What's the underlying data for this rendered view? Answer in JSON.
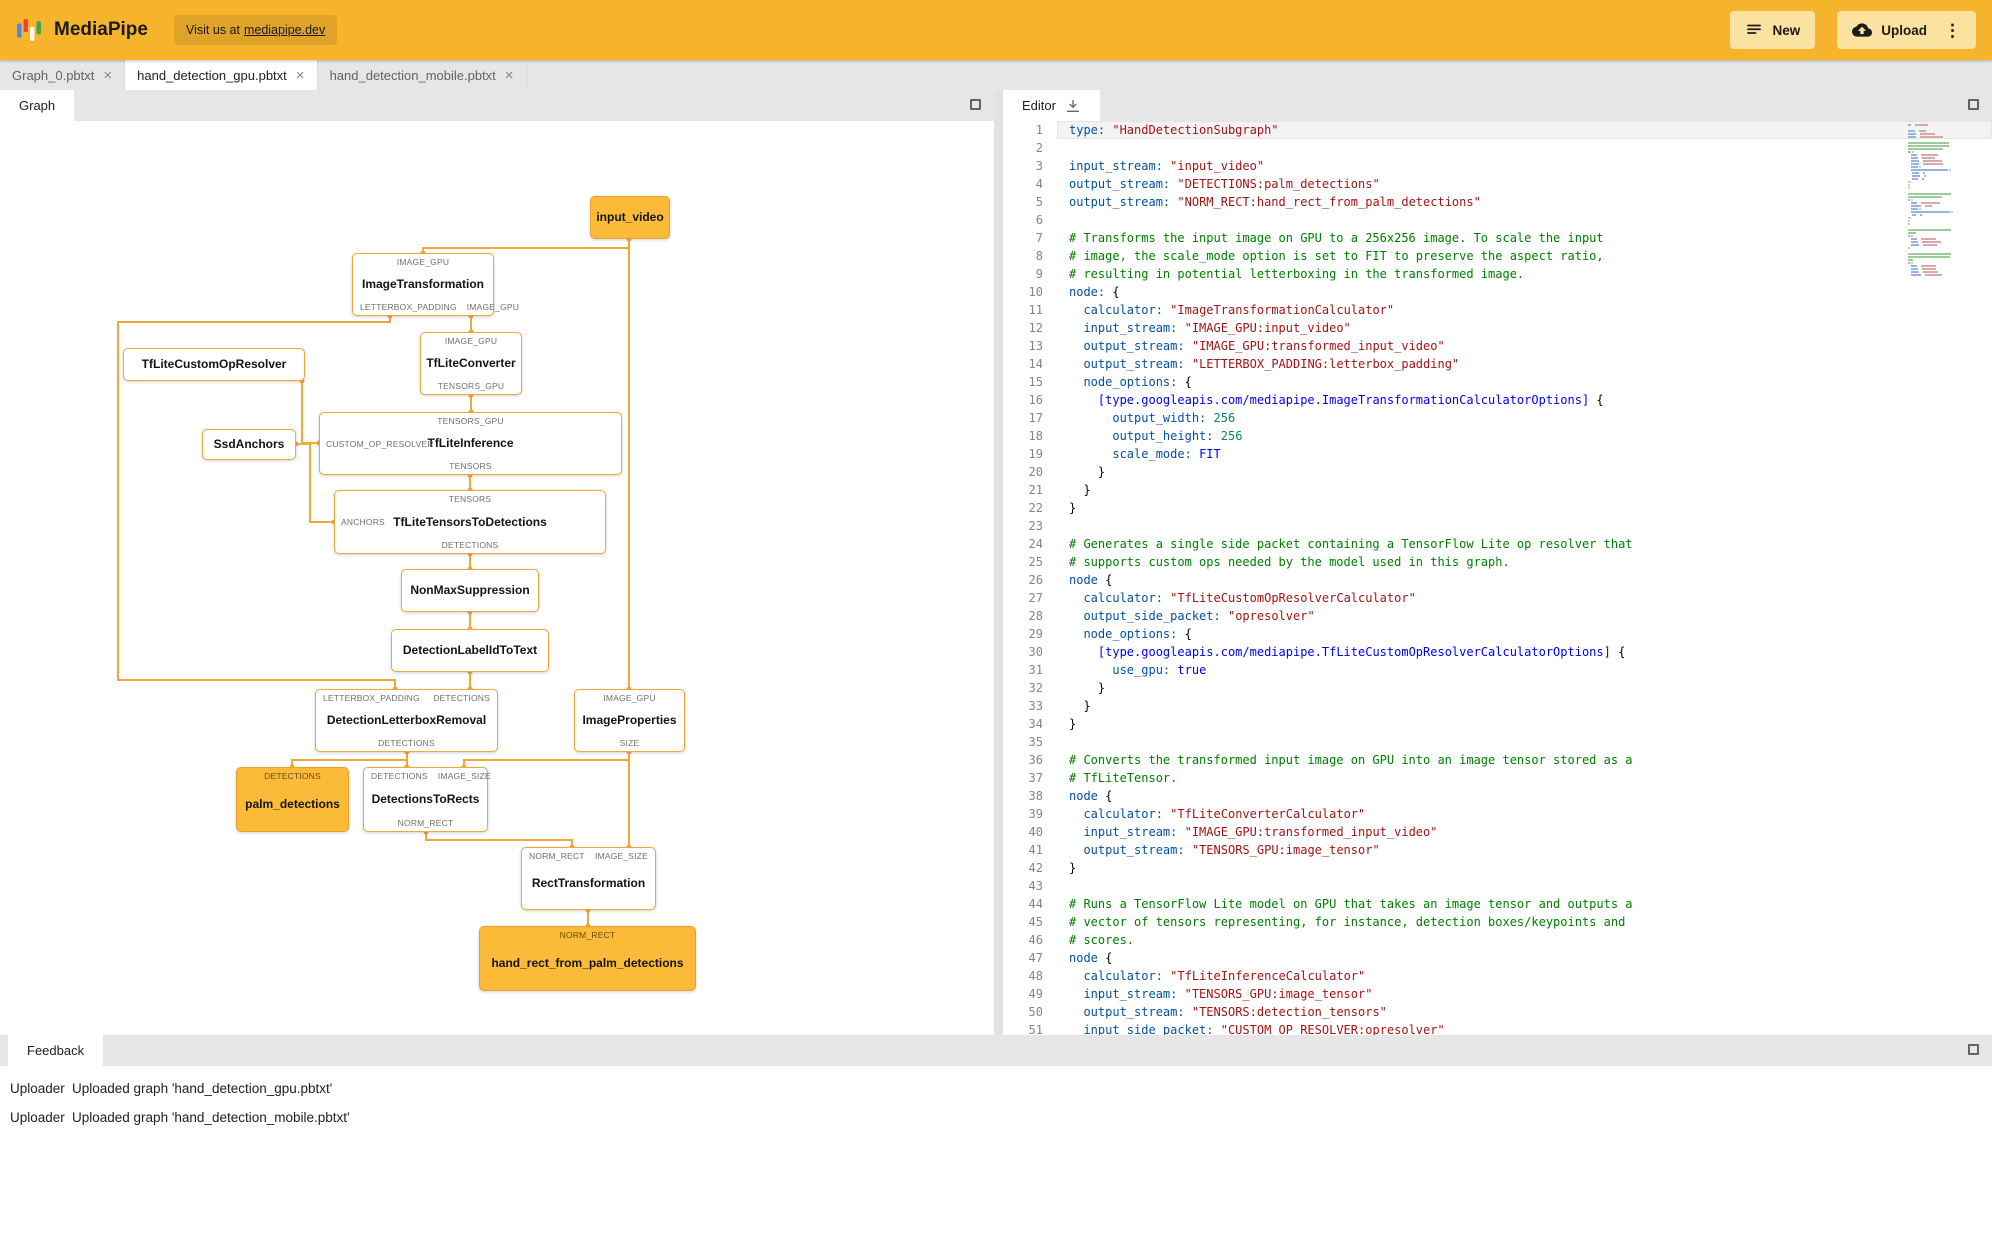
{
  "colors": {
    "header_bg": "#F6B42C",
    "badge_bg": "#DFA32A",
    "button_bg": "#FBE2A0",
    "edge_amber": "#F0A73C",
    "packet_fill": "#FBBA37",
    "packet_border": "#E8A02C",
    "code_key": "#0451A5",
    "code_string": "#A31515",
    "code_comment": "#008000",
    "code_number": "#098658",
    "code_keyword": "#0000FF"
  },
  "header": {
    "title": "MediaPipe",
    "visit_prefix": "Visit us at",
    "visit_link": "mediapipe.dev",
    "new_label": "New",
    "upload_label": "Upload"
  },
  "file_tabs": [
    {
      "label": "Graph_0.pbtxt",
      "active": false
    },
    {
      "label": "hand_detection_gpu.pbtxt",
      "active": true
    },
    {
      "label": "hand_detection_mobile.pbtxt",
      "active": false
    }
  ],
  "graph_panel": {
    "tab": "Graph",
    "nodes": [
      {
        "id": "input_video",
        "title": "input_video",
        "kind": "packet"
      },
      {
        "id": "ImageTransformation",
        "title": "ImageTransformation",
        "kind": "calc",
        "top_ports": [
          "IMAGE_GPU"
        ],
        "bottom_ports": [
          "LETTERBOX_PADDING",
          "IMAGE_GPU"
        ]
      },
      {
        "id": "TfLiteConverter",
        "title": "TfLiteConverter",
        "kind": "calc",
        "top_ports": [
          "IMAGE_GPU"
        ],
        "bottom_ports": [
          "TENSORS_GPU"
        ]
      },
      {
        "id": "TfLiteCustomOpResolver",
        "title": "TfLiteCustomOpResolver",
        "kind": "calc"
      },
      {
        "id": "SsdAnchors",
        "title": "SsdAnchors",
        "kind": "calc"
      },
      {
        "id": "TfLiteInference",
        "title": "TfLiteInference",
        "kind": "calc",
        "top_ports": [
          "TENSORS_GPU"
        ],
        "bottom_ports": [
          "TENSORS"
        ],
        "left_port": "CUSTOM_OP_RESOLVER"
      },
      {
        "id": "TfLiteTensorsToDetections",
        "title": "TfLiteTensorsToDetections",
        "kind": "calc",
        "top_ports": [
          "TENSORS"
        ],
        "bottom_ports": [
          "DETECTIONS"
        ],
        "left_port": "ANCHORS"
      },
      {
        "id": "NonMaxSuppression",
        "title": "NonMaxSuppression",
        "kind": "calc"
      },
      {
        "id": "DetectionLabelIdToText",
        "title": "DetectionLabelIdToText",
        "kind": "calc"
      },
      {
        "id": "DetectionLetterboxRemoval",
        "title": "DetectionLetterboxRemoval",
        "kind": "calc",
        "top_ports": [
          "LETTERBOX_PADDING",
          "DETECTIONS"
        ],
        "bottom_ports": [
          "DETECTIONS"
        ]
      },
      {
        "id": "ImageProperties",
        "title": "ImageProperties",
        "kind": "calc",
        "top_ports": [
          "IMAGE_GPU"
        ],
        "bottom_ports": [
          "SIZE"
        ]
      },
      {
        "id": "palm_detections",
        "title": "palm_detections",
        "kind": "packet",
        "top_ports": [
          "DETECTIONS"
        ]
      },
      {
        "id": "DetectionsToRects",
        "title": "DetectionsToRects",
        "kind": "calc",
        "top_ports": [
          "DETECTIONS",
          "IMAGE_SIZE"
        ],
        "bottom_ports": [
          "NORM_RECT"
        ]
      },
      {
        "id": "RectTransformation",
        "title": "RectTransformation",
        "kind": "calc",
        "top_ports": [
          "NORM_RECT",
          "IMAGE_SIZE"
        ]
      },
      {
        "id": "hand_rect_from_palm_detections",
        "title": "hand_rect_from_palm_detections",
        "kind": "packet",
        "top_ports": [
          "NORM_RECT"
        ]
      }
    ]
  },
  "editor_panel": {
    "tab": "Editor",
    "lines": [
      [
        [
          "k",
          "type:"
        ],
        [
          "p",
          " "
        ],
        [
          "s",
          "\"HandDetectionSubgraph\""
        ]
      ],
      [],
      [
        [
          "k",
          "input_stream:"
        ],
        [
          "p",
          " "
        ],
        [
          "s",
          "\"input_video\""
        ]
      ],
      [
        [
          "k",
          "output_stream:"
        ],
        [
          "p",
          " "
        ],
        [
          "s",
          "\"DETECTIONS:palm_detections\""
        ]
      ],
      [
        [
          "k",
          "output_stream:"
        ],
        [
          "p",
          " "
        ],
        [
          "s",
          "\"NORM_RECT:hand_rect_from_palm_detections\""
        ]
      ],
      [],
      [
        [
          "c",
          "# Transforms the input image on GPU to a 256x256 image. To scale the input"
        ]
      ],
      [
        [
          "c",
          "# image, the scale_mode option is set to FIT to preserve the aspect ratio,"
        ]
      ],
      [
        [
          "c",
          "# resulting in potential letterboxing in the transformed image."
        ]
      ],
      [
        [
          "k",
          "node:"
        ],
        [
          "p",
          " {"
        ]
      ],
      [
        [
          "p",
          "  "
        ],
        [
          "k",
          "calculator:"
        ],
        [
          "p",
          " "
        ],
        [
          "s",
          "\"ImageTransformationCalculator\""
        ]
      ],
      [
        [
          "p",
          "  "
        ],
        [
          "k",
          "input_stream:"
        ],
        [
          "p",
          " "
        ],
        [
          "s",
          "\"IMAGE_GPU:input_video\""
        ]
      ],
      [
        [
          "p",
          "  "
        ],
        [
          "k",
          "output_stream:"
        ],
        [
          "p",
          " "
        ],
        [
          "s",
          "\"IMAGE_GPU:transformed_input_video\""
        ]
      ],
      [
        [
          "p",
          "  "
        ],
        [
          "k",
          "output_stream:"
        ],
        [
          "p",
          " "
        ],
        [
          "s",
          "\"LETTERBOX_PADDING:letterbox_padding\""
        ]
      ],
      [
        [
          "p",
          "  "
        ],
        [
          "k",
          "node_options:"
        ],
        [
          "p",
          " {"
        ]
      ],
      [
        [
          "p",
          "    "
        ],
        [
          "w",
          "[type.googleapis.com/mediapipe.ImageTransformationCalculatorOptions]"
        ],
        [
          "p",
          " {"
        ]
      ],
      [
        [
          "p",
          "      "
        ],
        [
          "k",
          "output_width:"
        ],
        [
          "p",
          " "
        ],
        [
          "n",
          "256"
        ]
      ],
      [
        [
          "p",
          "      "
        ],
        [
          "k",
          "output_height:"
        ],
        [
          "p",
          " "
        ],
        [
          "n",
          "256"
        ]
      ],
      [
        [
          "p",
          "      "
        ],
        [
          "k",
          "scale_mode:"
        ],
        [
          "p",
          " "
        ],
        [
          "w",
          "FIT"
        ]
      ],
      [
        [
          "p",
          "    }"
        ]
      ],
      [
        [
          "p",
          "  }"
        ]
      ],
      [
        [
          "p",
          "}"
        ]
      ],
      [],
      [
        [
          "c",
          "# Generates a single side packet containing a TensorFlow Lite op resolver that"
        ]
      ],
      [
        [
          "c",
          "# supports custom ops needed by the model used in this graph."
        ]
      ],
      [
        [
          "k",
          "node"
        ],
        [
          "p",
          " {"
        ]
      ],
      [
        [
          "p",
          "  "
        ],
        [
          "k",
          "calculator:"
        ],
        [
          "p",
          " "
        ],
        [
          "s",
          "\"TfLiteCustomOpResolverCalculator\""
        ]
      ],
      [
        [
          "p",
          "  "
        ],
        [
          "k",
          "output_side_packet:"
        ],
        [
          "p",
          " "
        ],
        [
          "s",
          "\"opresolver\""
        ]
      ],
      [
        [
          "p",
          "  "
        ],
        [
          "k",
          "node_options:"
        ],
        [
          "p",
          " {"
        ]
      ],
      [
        [
          "p",
          "    "
        ],
        [
          "w",
          "[type.googleapis.com/mediapipe.TfLiteCustomOpResolverCalculatorOptions]"
        ],
        [
          "p",
          " {"
        ]
      ],
      [
        [
          "p",
          "      "
        ],
        [
          "k",
          "use_gpu:"
        ],
        [
          "p",
          " "
        ],
        [
          "w",
          "true"
        ]
      ],
      [
        [
          "p",
          "    }"
        ]
      ],
      [
        [
          "p",
          "  }"
        ]
      ],
      [
        [
          "p",
          "}"
        ]
      ],
      [],
      [
        [
          "c",
          "# Converts the transformed input image on GPU into an image tensor stored as a"
        ]
      ],
      [
        [
          "c",
          "# TfLiteTensor."
        ]
      ],
      [
        [
          "k",
          "node"
        ],
        [
          "p",
          " {"
        ]
      ],
      [
        [
          "p",
          "  "
        ],
        [
          "k",
          "calculator:"
        ],
        [
          "p",
          " "
        ],
        [
          "s",
          "\"TfLiteConverterCalculator\""
        ]
      ],
      [
        [
          "p",
          "  "
        ],
        [
          "k",
          "input_stream:"
        ],
        [
          "p",
          " "
        ],
        [
          "s",
          "\"IMAGE_GPU:transformed_input_video\""
        ]
      ],
      [
        [
          "p",
          "  "
        ],
        [
          "k",
          "output_stream:"
        ],
        [
          "p",
          " "
        ],
        [
          "s",
          "\"TENSORS_GPU:image_tensor\""
        ]
      ],
      [
        [
          "p",
          "}"
        ]
      ],
      [],
      [
        [
          "c",
          "# Runs a TensorFlow Lite model on GPU that takes an image tensor and outputs a"
        ]
      ],
      [
        [
          "c",
          "# vector of tensors representing, for instance, detection boxes/keypoints and"
        ]
      ],
      [
        [
          "c",
          "# scores."
        ]
      ],
      [
        [
          "k",
          "node"
        ],
        [
          "p",
          " {"
        ]
      ],
      [
        [
          "p",
          "  "
        ],
        [
          "k",
          "calculator:"
        ],
        [
          "p",
          " "
        ],
        [
          "s",
          "\"TfLiteInferenceCalculator\""
        ]
      ],
      [
        [
          "p",
          "  "
        ],
        [
          "k",
          "input_stream:"
        ],
        [
          "p",
          " "
        ],
        [
          "s",
          "\"TENSORS_GPU:image_tensor\""
        ]
      ],
      [
        [
          "p",
          "  "
        ],
        [
          "k",
          "output_stream:"
        ],
        [
          "p",
          " "
        ],
        [
          "s",
          "\"TENSORS:detection_tensors\""
        ]
      ],
      [
        [
          "p",
          "  "
        ],
        [
          "k",
          "input_side_packet:"
        ],
        [
          "p",
          " "
        ],
        [
          "s",
          "\"CUSTOM_OP_RESOLVER:opresolver\""
        ]
      ]
    ]
  },
  "feedback_panel": {
    "tab": "Feedback",
    "entries": [
      {
        "source": "Uploader",
        "message": "Uploaded graph 'hand_detection_gpu.pbtxt'"
      },
      {
        "source": "Uploader",
        "message": "Uploaded graph 'hand_detection_mobile.pbtxt'"
      }
    ]
  }
}
